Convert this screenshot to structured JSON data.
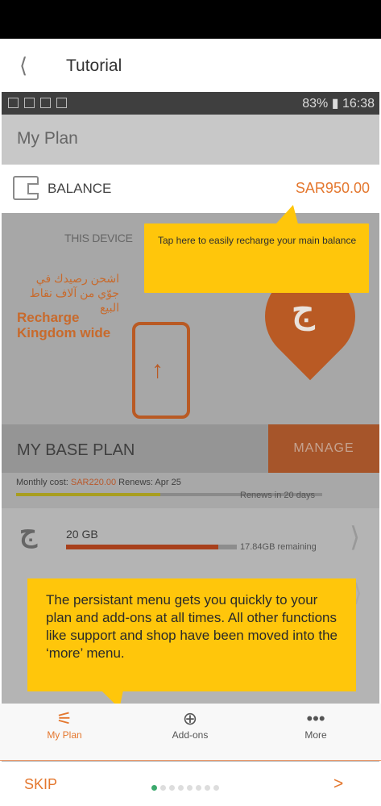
{
  "header": {
    "back_icon": "chevron-left-icon",
    "title": "Tutorial"
  },
  "device_status": {
    "right": "83% ▮ 16:38"
  },
  "plan": {
    "title": "My Plan",
    "balance_label": "BALANCE",
    "balance_amount": "SAR950.00",
    "this_device": "THIS DEVICE",
    "promo_arabic": "اشحن رصيدك في جوّي من آلاف نقاط البيع",
    "promo_english": "Recharge Kingdom wide",
    "base_plan_title": "MY BASE PLAN",
    "manage_label": "MANAGE",
    "cost_prefix": "Monthly cost: ",
    "cost_value": "SAR220.00",
    "cost_renews": "  Renews: Apr 25",
    "renews_in": "Renews in 20 days",
    "renew_progress": 0.47,
    "data_amount": "20 GB",
    "data_remaining": "17.84GB remaining",
    "data_progress": 0.89
  },
  "tooltips": {
    "balance_tip": "Tap here to easily recharge your main balance",
    "menu_tip": "The persistant menu gets you quickly to your plan and add-ons at all times. All other functions like support and shop have been moved into the ‘more’ menu."
  },
  "bottom_nav": {
    "items": [
      {
        "label": "My Plan",
        "icon": "sliders-icon"
      },
      {
        "label": "Add-ons",
        "icon": "plus-circle-icon"
      },
      {
        "label": "More",
        "icon": "more-dots-icon"
      }
    ]
  },
  "pager": {
    "skip": "SKIP",
    "next": ">",
    "total_dots": 8,
    "active_dot": 0
  },
  "colors": {
    "accent": "#e4772e",
    "tooltip": "#ffc60b",
    "manage_bg": "#a6552a"
  }
}
